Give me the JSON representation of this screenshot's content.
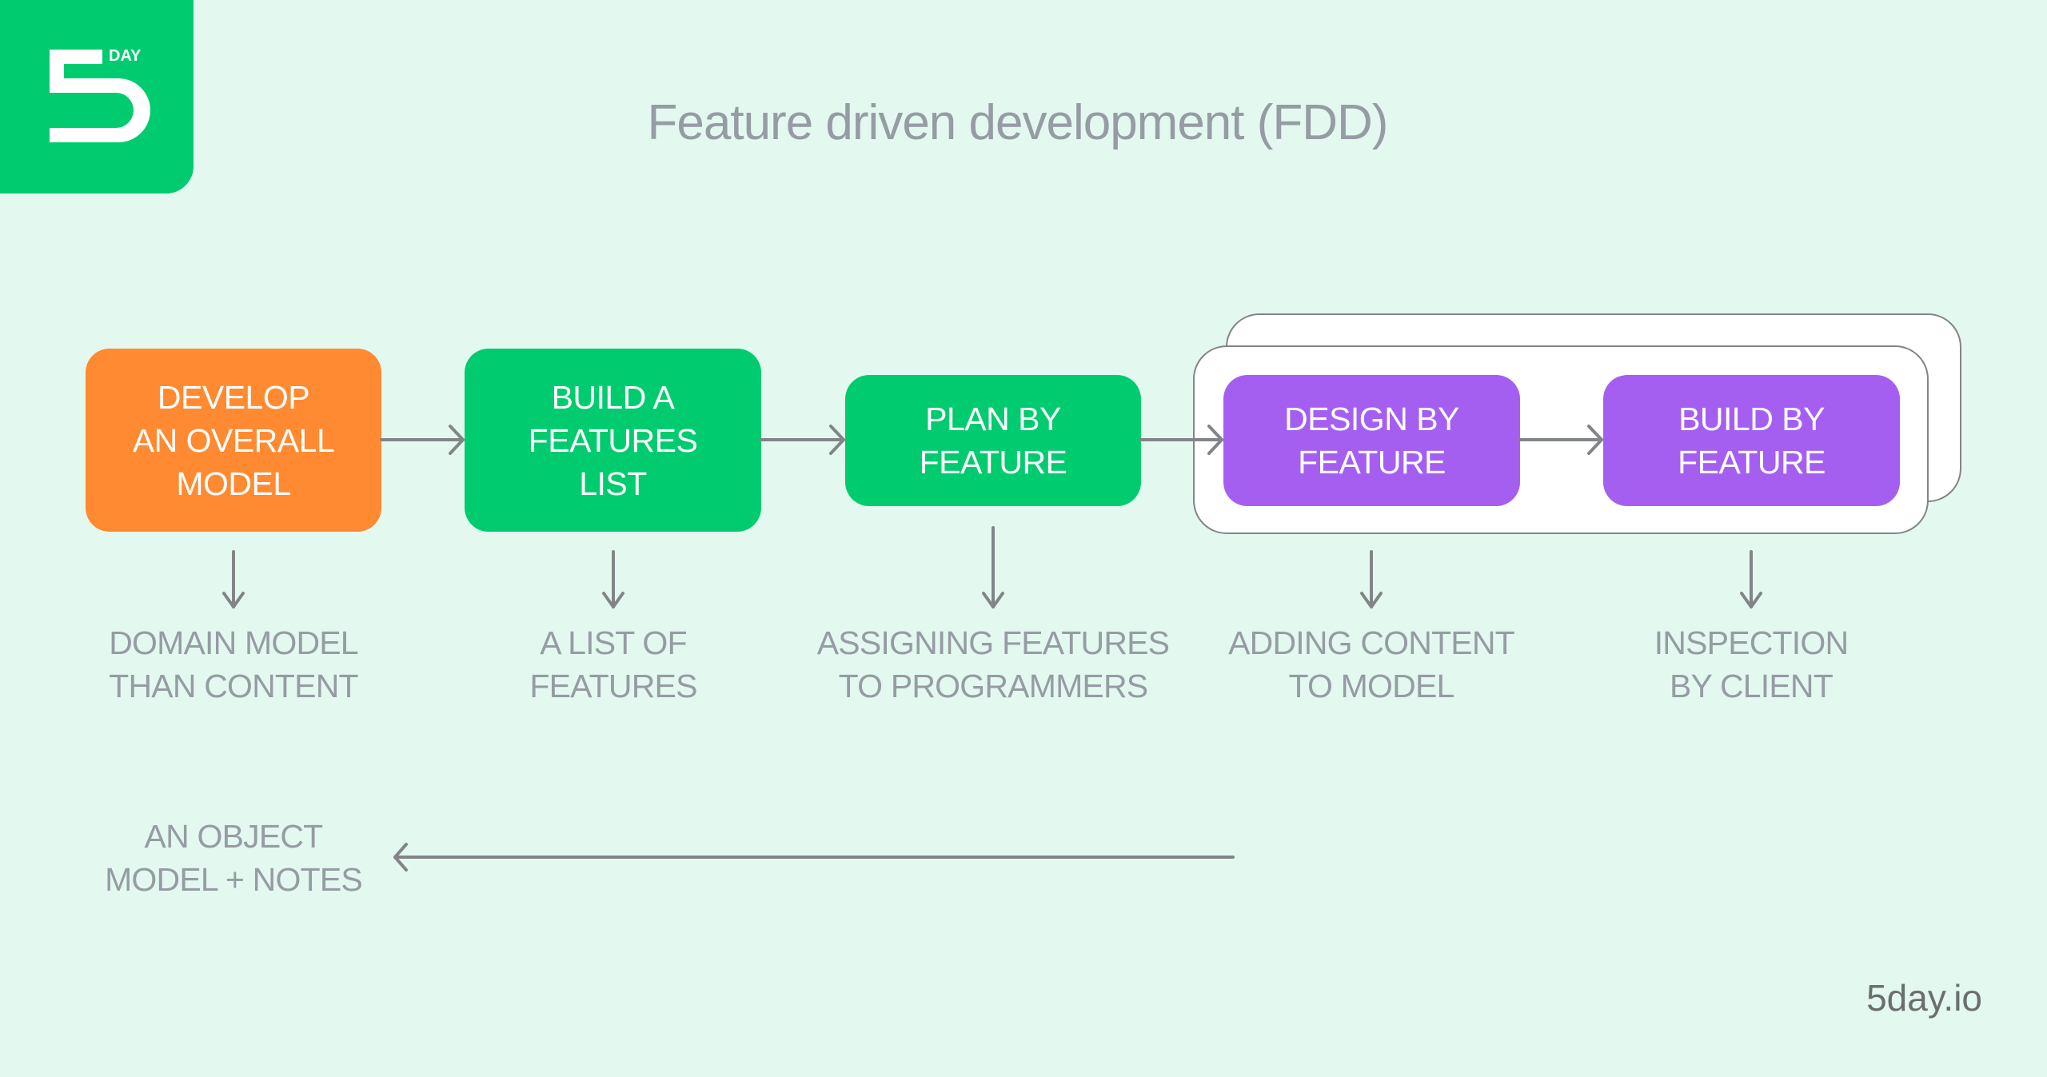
{
  "brand": {
    "logo_text": "DAY",
    "logo_digit": "5",
    "logo_icon": "5day-logo-icon",
    "site": "5day.io",
    "colors": {
      "green": "#00cc6f",
      "orange": "#ff8a31",
      "purple": "#a55ff0",
      "background": "#e3f9f0",
      "text_gray": "#969ca3",
      "arrow": "#828588"
    }
  },
  "title": "Feature driven development (FDD)",
  "steps": [
    {
      "label": "DEVELOP\nAN OVERALL\nMODEL",
      "color": "orange",
      "output": "DOMAIN MODEL\nTHAN CONTENT"
    },
    {
      "label": "BUILD A\nFEATURES\nLIST",
      "color": "green",
      "output": "A LIST OF\nFEATURES"
    },
    {
      "label": "PLAN BY\nFEATURE",
      "color": "green",
      "output": "ASSIGNING FEATURES\nTO PROGRAMMERS"
    },
    {
      "label": "DESIGN BY\nFEATURE",
      "color": "purple",
      "output": "ADDING CONTENT\nTO MODEL"
    },
    {
      "label": "BUILD BY\nFEATURE",
      "color": "purple",
      "output": "INSPECTION\nBY CLIENT"
    }
  ],
  "final_output": "AN OBJECT\nMODEL + NOTES"
}
